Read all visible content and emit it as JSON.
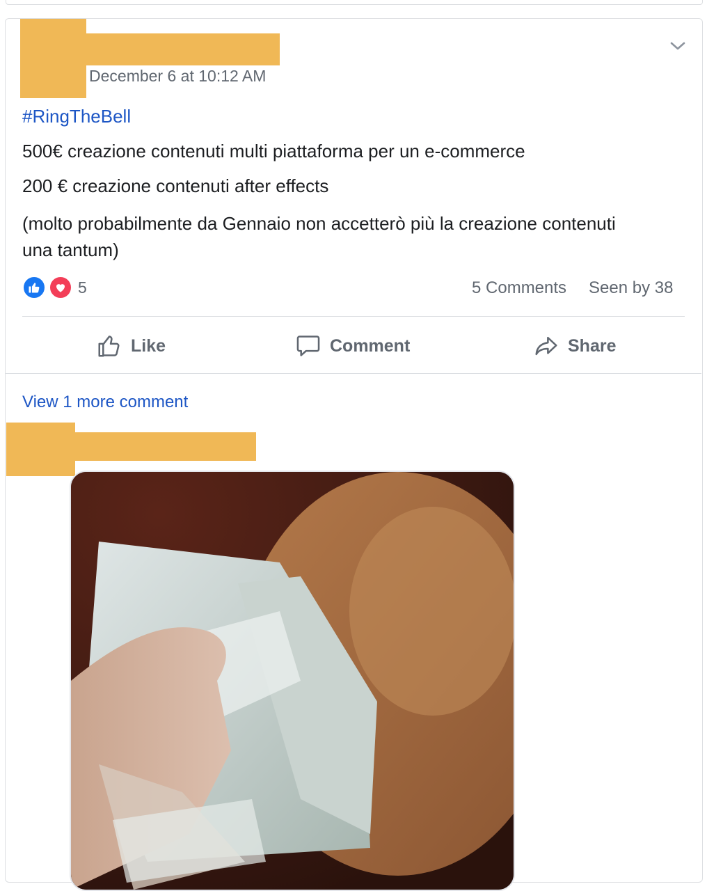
{
  "post": {
    "timestamp": "December 6 at 10:12 AM",
    "hashtag": "#RingTheBell",
    "lines": [
      "500€ creazione contenuti multi piattaforma per un e-commerce",
      "200 € creazione contenuti after effects",
      "(molto probabilmente da Gennaio non accetterò più la creazione contenuti una tantum)"
    ],
    "reactions": {
      "count": "5",
      "types": [
        "like-icon",
        "love-icon"
      ]
    },
    "comments_count": "5 Comments",
    "seen_by": "Seen by 38"
  },
  "actions": {
    "like_label": "Like",
    "comment_label": "Comment",
    "share_label": "Share"
  },
  "comments": {
    "view_more_label": "View 1 more comment"
  },
  "colors": {
    "redaction": "#f0b856",
    "link": "#1d56c5",
    "muted": "#606770",
    "like": "#1877f2",
    "love": "#f33e58"
  }
}
